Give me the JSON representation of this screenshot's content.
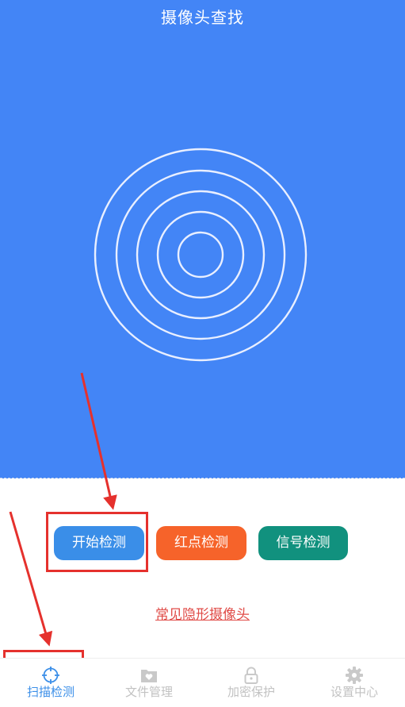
{
  "header": {
    "title": "摄像头查找"
  },
  "actions": {
    "start_detection": "开始检测",
    "red_dot_detection": "红点检测",
    "signal_detection": "信号检测"
  },
  "link": {
    "hidden_cameras": "常见隐形摄像头"
  },
  "tabbar": {
    "items": [
      {
        "label": "扫描检测",
        "icon": "crosshair-icon",
        "active": true
      },
      {
        "label": "文件管理",
        "icon": "folder-heart-icon",
        "active": false
      },
      {
        "label": "加密保护",
        "icon": "lock-icon",
        "active": false
      },
      {
        "label": "设置中心",
        "icon": "gear-icon",
        "active": false
      }
    ]
  },
  "colors": {
    "header_bg": "#4385f6",
    "start_button": "#3a8ee8",
    "red_dot_button": "#f6632a",
    "signal_button": "#11917e",
    "annotation": "#e5312d",
    "link": "#e04b47",
    "tab_active": "#3a8ee8",
    "tab_inactive": "#c2c2c2"
  }
}
